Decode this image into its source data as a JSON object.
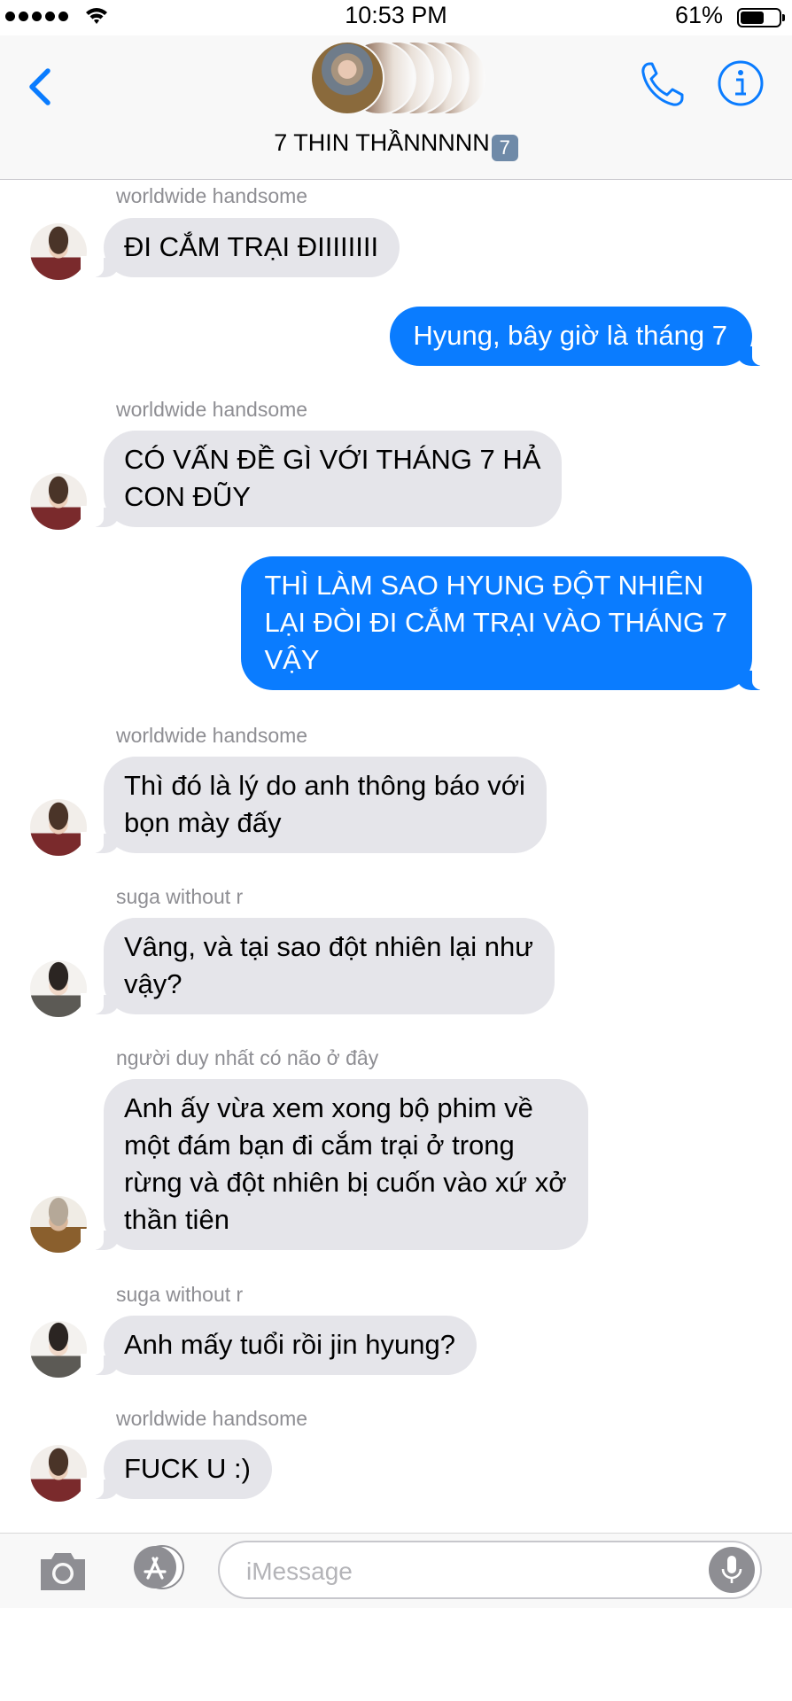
{
  "status_bar": {
    "time": "10:53 PM",
    "battery_percent": "61%",
    "battery_level": 0.61
  },
  "header": {
    "group_name": "7 THIN THẦNNNNN",
    "keycap": "7"
  },
  "messages": [
    {
      "sender": "worldwide handsome",
      "text": "ĐI CẮM TRẠI ĐIIIIIIII",
      "direction": "in"
    },
    {
      "text": "Hyung, bây giờ là tháng 7",
      "direction": "out"
    },
    {
      "sender": "worldwide handsome",
      "lines": [
        "CÓ VẤN ĐỀ GÌ VỚI THÁNG 7 HẢ",
        "CON ĐŨY"
      ],
      "direction": "in"
    },
    {
      "lines": [
        "THÌ LÀM SAO HYUNG ĐỘT NHIÊN",
        "LẠI ĐÒI ĐI CẮM TRẠI VÀO THÁNG 7",
        "VẬY"
      ],
      "direction": "out"
    },
    {
      "sender": "worldwide handsome",
      "lines": [
        "Thì đó là lý do anh thông báo với",
        "bọn mày đấy"
      ],
      "direction": "in"
    },
    {
      "sender": "suga without r",
      "lines": [
        "Vâng, và tại sao đột nhiên lại như",
        "vậy?"
      ],
      "direction": "in"
    },
    {
      "sender": "người duy nhất có não ở đây",
      "lines": [
        "Anh ấy vừa xem xong bộ phim về",
        "một đám bạn đi cắm trại ở trong",
        "rừng và đột nhiên bị cuốn vào xứ xở",
        "thần tiên"
      ],
      "direction": "in"
    },
    {
      "sender": "suga without r",
      "text": "Anh mấy tuổi rồi jin hyung?",
      "direction": "in"
    },
    {
      "sender": "worldwide handsome",
      "text": "FUCK U :)",
      "direction": "in"
    }
  ],
  "composer": {
    "placeholder": "iMessage"
  }
}
